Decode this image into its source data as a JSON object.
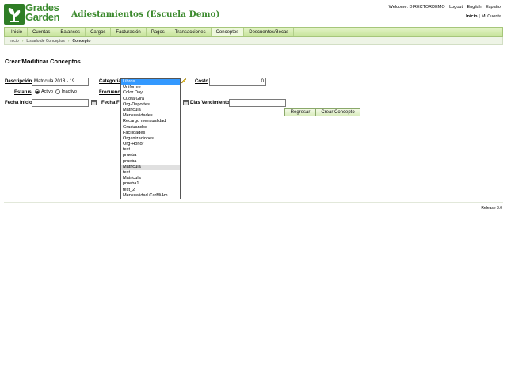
{
  "header": {
    "logo_line1": "Grades",
    "logo_line2": "Garden",
    "app_title": "Adiestamientos (Escuela Demo)",
    "welcome": "Welcome: DIRECTORDEMO",
    "logout": "Logout",
    "english": "English",
    "espanol": "Español",
    "inicio": "Inicio",
    "mi_cuenta": "Mi Cuenta"
  },
  "nav": {
    "items": [
      "Inicio",
      "Cuentas",
      "Balances",
      "Cargos",
      "Facturación",
      "Pagos",
      "Transacciones",
      "Conceptos",
      "Descuentos/Becas"
    ],
    "active": "Conceptos"
  },
  "breadcrumb": [
    "Inicio",
    "Listado de Conceptos",
    "Concepto"
  ],
  "page_title": "Crear/Modificar Conceptos",
  "form": {
    "descripcion_label": "Descripción",
    "descripcion_value": "Matricula 2018 - 19",
    "categoria_label": "Categoría",
    "costo_label": "Costo",
    "costo_value": "0",
    "estatus_label": "Estatus",
    "activo_label": "Activo",
    "inactivo_label": "Inactivo",
    "frecuencia_label": "Frecuencia",
    "fecha_inicio_label": "Fecha Inicio",
    "fecha_fin_label": "Fecha Fin",
    "dias_vencimiento_label": "Dias Vencimiento",
    "regresar_label": "Regresar",
    "crear_label": "Crear Concepto"
  },
  "dropdown": {
    "options": [
      "Libros",
      "Uniforme",
      "Color Day",
      "Cuota Gira",
      "Org-Deportes",
      "Matricula",
      "Mensualidades",
      "Recargo mensualidad",
      "Graduandos",
      "Facilidades",
      "Organizaciones",
      "Org-Honor",
      "test",
      "prueba",
      "prueba",
      "Matricula",
      "test",
      "Matricula",
      "prueba1",
      "test_2",
      "Mensualidad CarMiAm"
    ],
    "selected_index": 0,
    "hover_index": 15
  },
  "footer": {
    "release": "Release 3.0"
  },
  "colors": {
    "brand_green": "#3b8b2e",
    "nav_bg": "#c6e39a",
    "selection": "#3399ff"
  }
}
